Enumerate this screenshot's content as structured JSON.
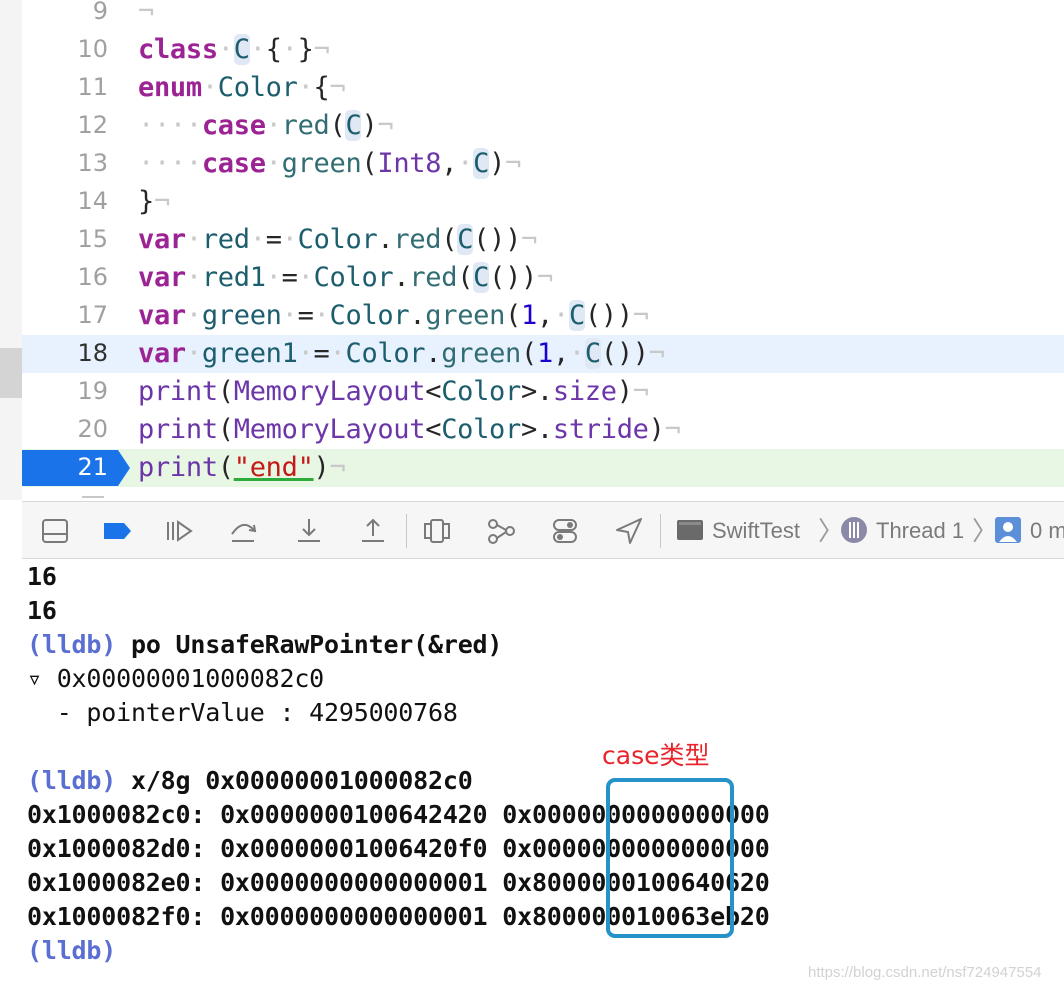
{
  "editor": {
    "lines": [
      {
        "num": "9"
      },
      {
        "num": "10"
      },
      {
        "num": "11"
      },
      {
        "num": "12"
      },
      {
        "num": "13"
      },
      {
        "num": "14"
      },
      {
        "num": "15"
      },
      {
        "num": "16"
      },
      {
        "num": "17"
      },
      {
        "num": "18"
      },
      {
        "num": "19"
      },
      {
        "num": "20"
      },
      {
        "num": "21"
      }
    ],
    "current_line": "18",
    "breakpoint_line": "21"
  },
  "toolbar": {
    "scheme": "SwiftTest",
    "thread": "Thread 1",
    "frame": "0 m"
  },
  "console": {
    "lines": [
      "16",
      "16",
      "(lldb) po UnsafeRawPointer(&red)",
      "▿ 0x00000001000082c0",
      "  - pointerValue : 4295000768",
      "(lldb) x/8g 0x00000001000082c0",
      "0x1000082c0: 0x0000000100642420 0x0000000000000000",
      "0x1000082d0: 0x00000001006420f0 0x0000000000000000",
      "0x1000082e0: 0x0000000000000001 0x8000000100640620",
      "0x1000082f0: 0x0000000000000001 0x800000010063eb20",
      "(lldb)"
    ]
  },
  "annotation": {
    "label": "case类型",
    "color": "#e8242c",
    "box_color": "#2592c8"
  },
  "watermark": "https://blog.csdn.net/nsf724947554",
  "colors": {
    "keyword": "#9b2393",
    "type": "#1c5e6e",
    "number": "#1c00cf",
    "string": "#c41a16",
    "current_line_bg": "#e8f2fe",
    "breakpoint_line_bg": "#e7f7e3",
    "breakpoint": "#1a73e8",
    "lldb_prompt": "#5a6fd1"
  }
}
